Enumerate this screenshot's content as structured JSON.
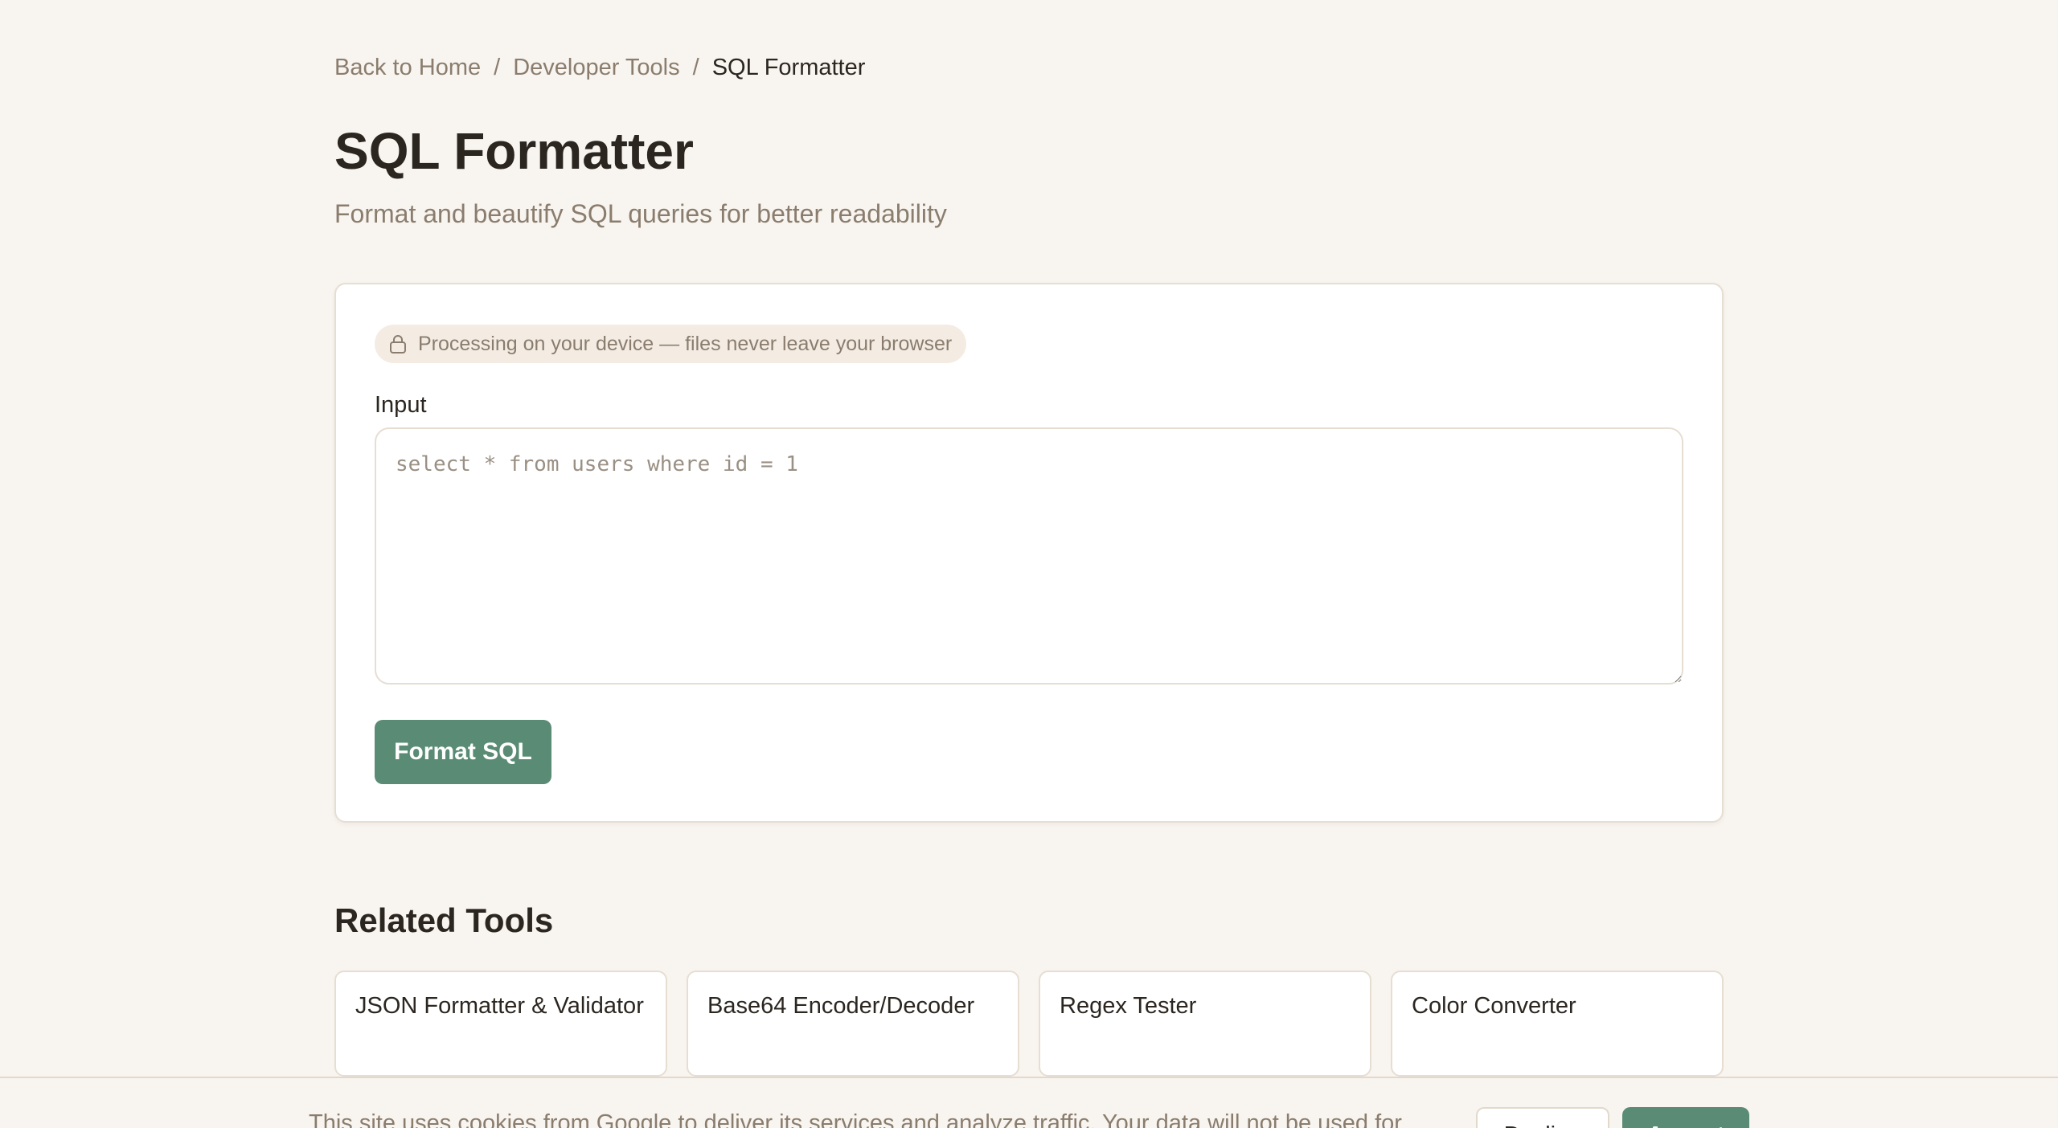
{
  "breadcrumb": {
    "home": "Back to Home",
    "category": "Developer Tools",
    "current": "SQL Formatter",
    "separator": "/"
  },
  "header": {
    "title": "SQL Formatter",
    "subtitle": "Format and beautify SQL queries for better readability"
  },
  "tool": {
    "privacy_badge": "Processing on your device — files never leave your browser",
    "privacy_icon": "lock-icon",
    "input_label": "Input",
    "input_placeholder": "select * from users where id = 1",
    "input_value": "",
    "format_button": "Format SQL"
  },
  "related": {
    "heading": "Related Tools",
    "tools": [
      {
        "label": "JSON Formatter & Validator"
      },
      {
        "label": "Base64 Encoder/Decoder"
      },
      {
        "label": "Regex Tester"
      },
      {
        "label": "Color Converter"
      }
    ]
  },
  "cookie_banner": {
    "text": "This site uses cookies from Google to deliver its services and analyze traffic. Your data will not be used for",
    "decline_label": "Decline",
    "accept_label": "Accept"
  },
  "colors": {
    "background": "#f8f4ef",
    "accent": "#5a8b74",
    "text": "#2b2620",
    "muted_text": "#8a7d6e",
    "border": "#e6ded3"
  }
}
